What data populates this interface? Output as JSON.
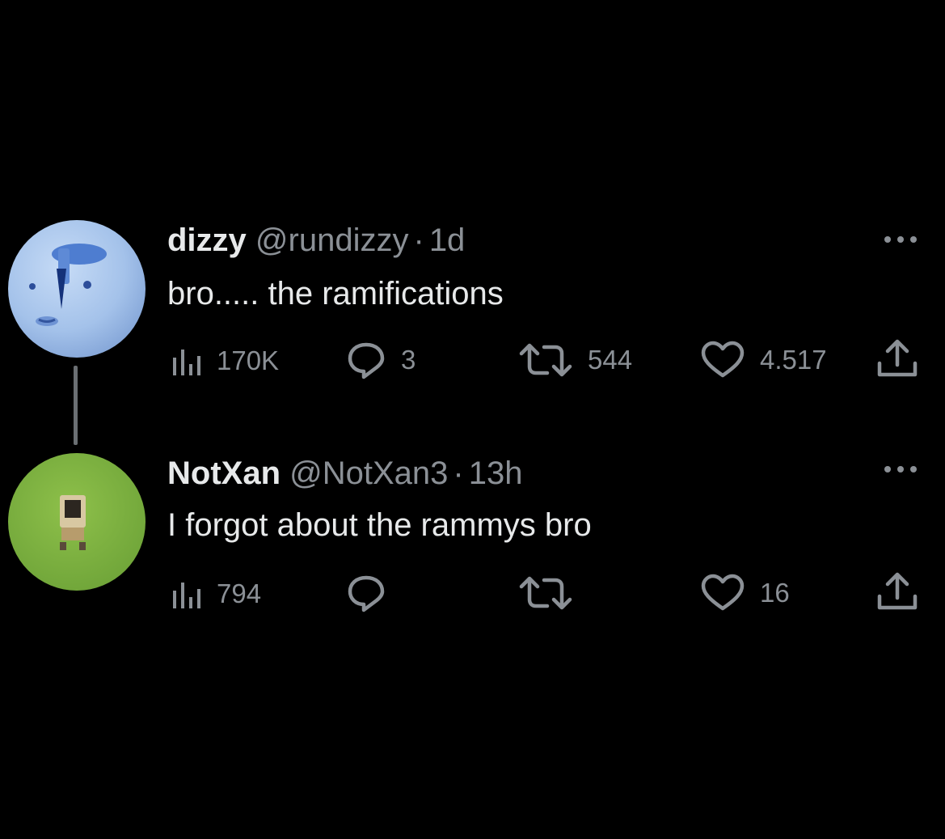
{
  "tweets": [
    {
      "display_name": "dizzy",
      "handle": "@rundizzy",
      "separator": "·",
      "time": "1d",
      "text": "bro.....  the ramifications",
      "views": "170K",
      "replies": "3",
      "reposts": "544",
      "likes": "4.517",
      "avatar_color": "#a7c5ec"
    },
    {
      "display_name": "NotXan",
      "handle": "@NotXan3",
      "separator": "·",
      "time": "13h",
      "text": "I forgot about the rammys bro",
      "views": "794",
      "avatar_color": "#79b040",
      "likes": "16"
    }
  ],
  "icons": {
    "views": "views-bar-chart-icon",
    "reply": "reply-bubble-icon",
    "repost": "repost-arrows-icon",
    "like": "heart-icon",
    "share": "share-upload-icon",
    "more": "more-dots-icon"
  },
  "colors": {
    "background": "#000000",
    "text": "#e7e9ea",
    "secondary": "#8b9096"
  }
}
